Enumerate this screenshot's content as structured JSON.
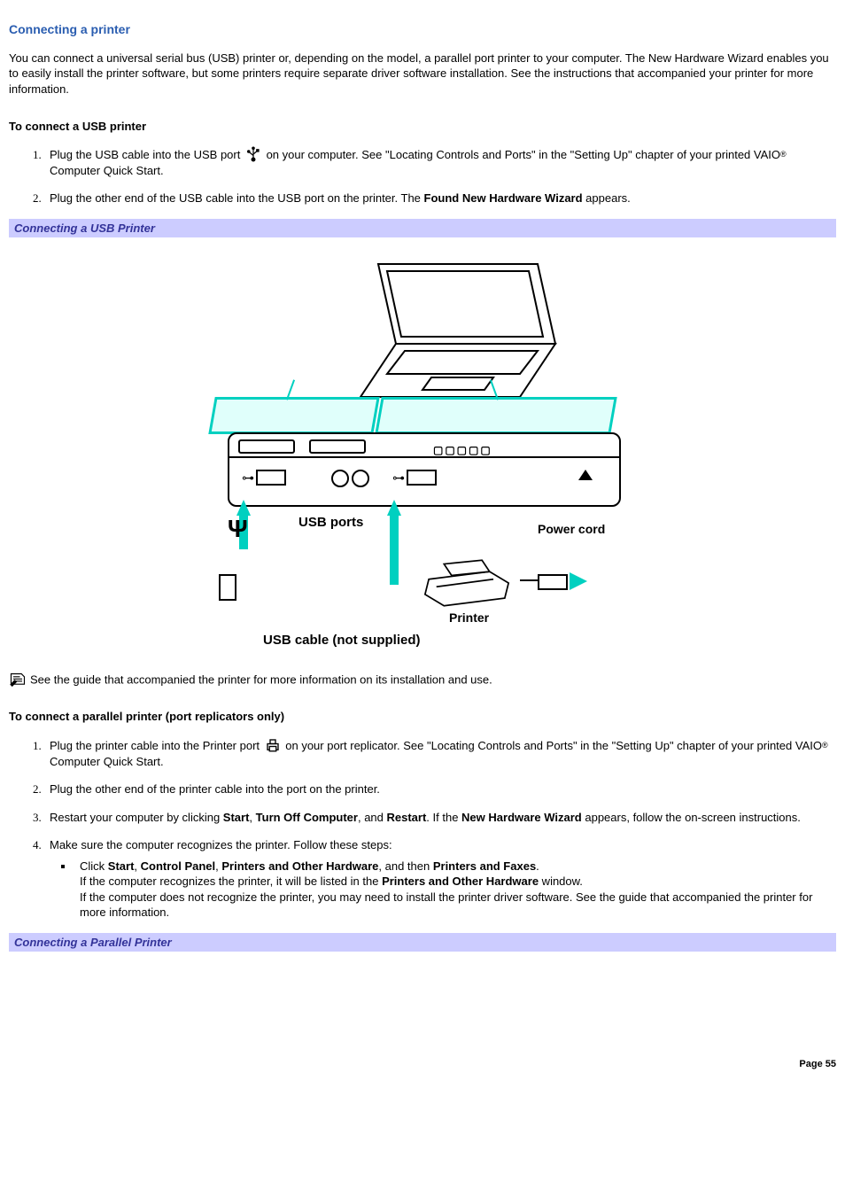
{
  "heading": "Connecting a printer",
  "intro": "You can connect a universal serial bus (USB) printer or, depending on the model, a parallel port printer to your computer. The New Hardware Wizard enables you to easily install the printer software, but some printers require separate driver software installation. See the instructions that accompanied your printer for more information.",
  "usb": {
    "subheading": "To connect a USB printer",
    "step1_a": "Plug the USB cable into the USB port ",
    "step1_b": " on your computer. See \"Locating Controls and Ports\" in the \"Setting Up\" chapter of your printed VAIO",
    "step1_c": " Computer Quick Start.",
    "step2_a": "Plug the other end of the USB cable into the USB port on the printer. The ",
    "step2_bold": "Found New Hardware Wizard",
    "step2_b": " appears.",
    "caption": "Connecting a USB Printer",
    "fig": {
      "usb_ports": "USB ports",
      "power_cord": "Power cord",
      "printer": "Printer",
      "cable": "USB cable (not supplied)"
    }
  },
  "reg": "®",
  "note": "See the guide that accompanied the printer for more information on its installation and use.",
  "parallel": {
    "subheading": "To connect a parallel printer (port replicators only)",
    "step1_a": "Plug the printer cable into the Printer port ",
    "step1_b": " on your port replicator. See \"Locating Controls and Ports\" in the \"Setting Up\" chapter of your printed VAIO",
    "step1_c": " Computer Quick Start.",
    "step2": "Plug the other end of the printer cable into the port on the printer.",
    "step3_a": "Restart your computer by clicking ",
    "step3_b1": "Start",
    "step3_s1": ", ",
    "step3_b2": "Turn Off Computer",
    "step3_s2": ", and ",
    "step3_b3": "Restart",
    "step3_s3": ". If the ",
    "step3_b4": "New Hardware Wizard",
    "step3_c": " appears, follow the on-screen instructions.",
    "step4": "Make sure the computer recognizes the printer. Follow these steps:",
    "bullet_a": "Click ",
    "bullet_b1": "Start",
    "bullet_s1": ", ",
    "bullet_b2": "Control Panel",
    "bullet_s2": ", ",
    "bullet_b3": "Printers and Other Hardware",
    "bullet_s3": ", and then ",
    "bullet_b4": "Printers and Faxes",
    "bullet_s4": ".",
    "bullet_line2a": "If the computer recognizes the printer, it will be listed in the ",
    "bullet_line2b": "Printers and Other Hardware",
    "bullet_line2c": " window.",
    "bullet_line3": "If the computer does not recognize the printer, you may need to install the printer driver software. See the guide that accompanied the printer for more information.",
    "caption": "Connecting a Parallel Printer"
  },
  "footer": "Page 55"
}
